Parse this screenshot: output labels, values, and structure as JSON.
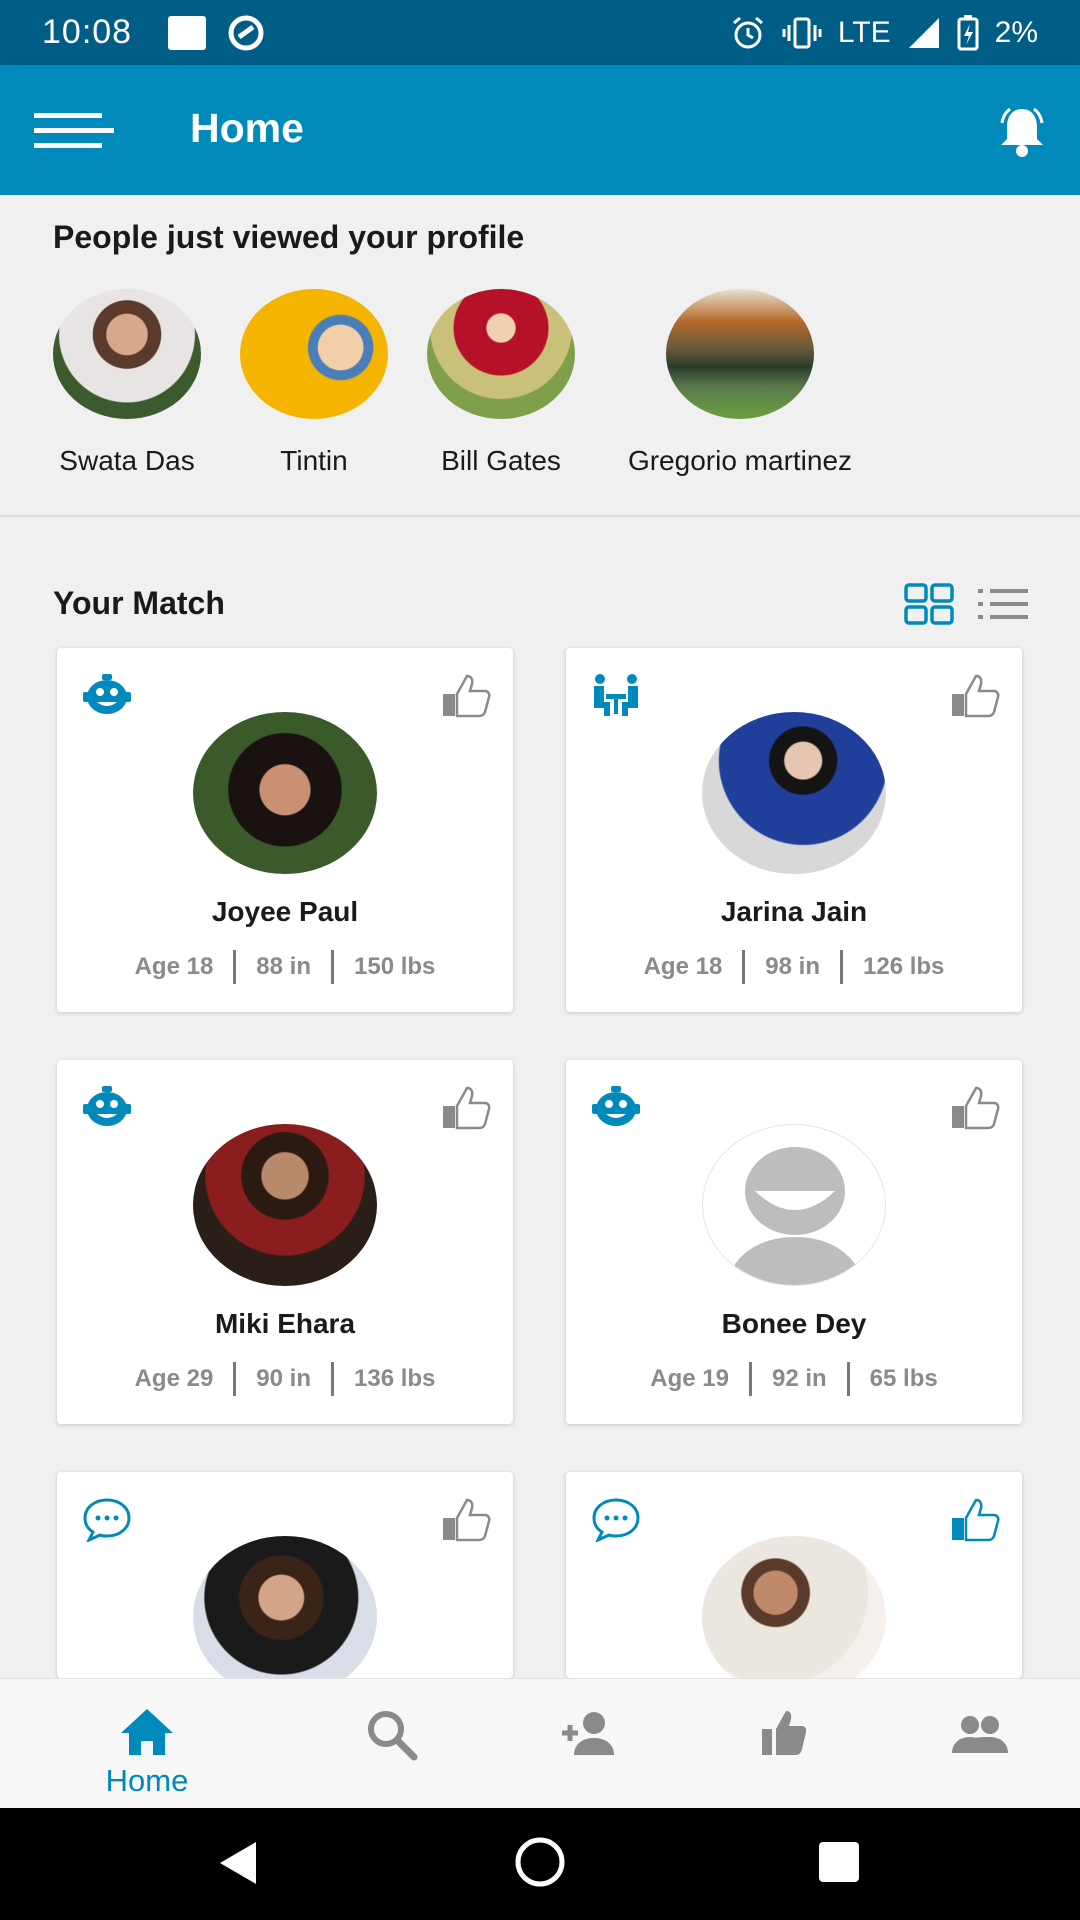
{
  "status_bar": {
    "time": "10:08",
    "network": "LTE",
    "battery": "2%"
  },
  "app_bar": {
    "title": "Home",
    "menu_icon": "menu-icon",
    "notification_icon": "bell-icon"
  },
  "viewed": {
    "title": "People just viewed your profile",
    "people": [
      {
        "name": "Swata Das"
      },
      {
        "name": "Tintin"
      },
      {
        "name": "Bill Gates"
      },
      {
        "name": "Gregorio martinez"
      }
    ]
  },
  "matches": {
    "title": "Your Match",
    "view_toggles": [
      "grid-view-icon",
      "list-view-icon"
    ],
    "cards": [
      {
        "name": "Joyee Paul",
        "age": "Age 18",
        "height": "88 in",
        "weight": "150 lbs",
        "type_icon": "smiley-robot-icon",
        "liked": false
      },
      {
        "name": "Jarina Jain",
        "age": "Age 18",
        "height": "98 in",
        "weight": "126 lbs",
        "type_icon": "meeting-icon",
        "liked": false
      },
      {
        "name": "Miki Ehara",
        "age": "Age 29",
        "height": "90 in",
        "weight": "136 lbs",
        "type_icon": "smiley-robot-icon",
        "liked": false
      },
      {
        "name": "Bonee Dey",
        "age": "Age 19",
        "height": "92 in",
        "weight": "65 lbs",
        "type_icon": "smiley-robot-icon",
        "liked": false
      },
      {
        "name": "",
        "age": "",
        "height": "",
        "weight": "",
        "type_icon": "chat-bubble-icon",
        "liked": false
      },
      {
        "name": "",
        "age": "",
        "height": "",
        "weight": "",
        "type_icon": "chat-bubble-icon",
        "liked": true
      }
    ]
  },
  "bottom_nav": {
    "items": [
      {
        "label": "Home",
        "icon": "home-icon",
        "active": true
      },
      {
        "label": "",
        "icon": "search-icon",
        "active": false
      },
      {
        "label": "",
        "icon": "add-person-icon",
        "active": false
      },
      {
        "label": "",
        "icon": "thumbs-up-icon",
        "active": false
      },
      {
        "label": "",
        "icon": "group-icon",
        "active": false
      }
    ]
  },
  "colors": {
    "primary": "#0089bb",
    "status_bar": "#005d85",
    "icon_gray": "#8a8a8a",
    "text": "#1a1a1a"
  }
}
